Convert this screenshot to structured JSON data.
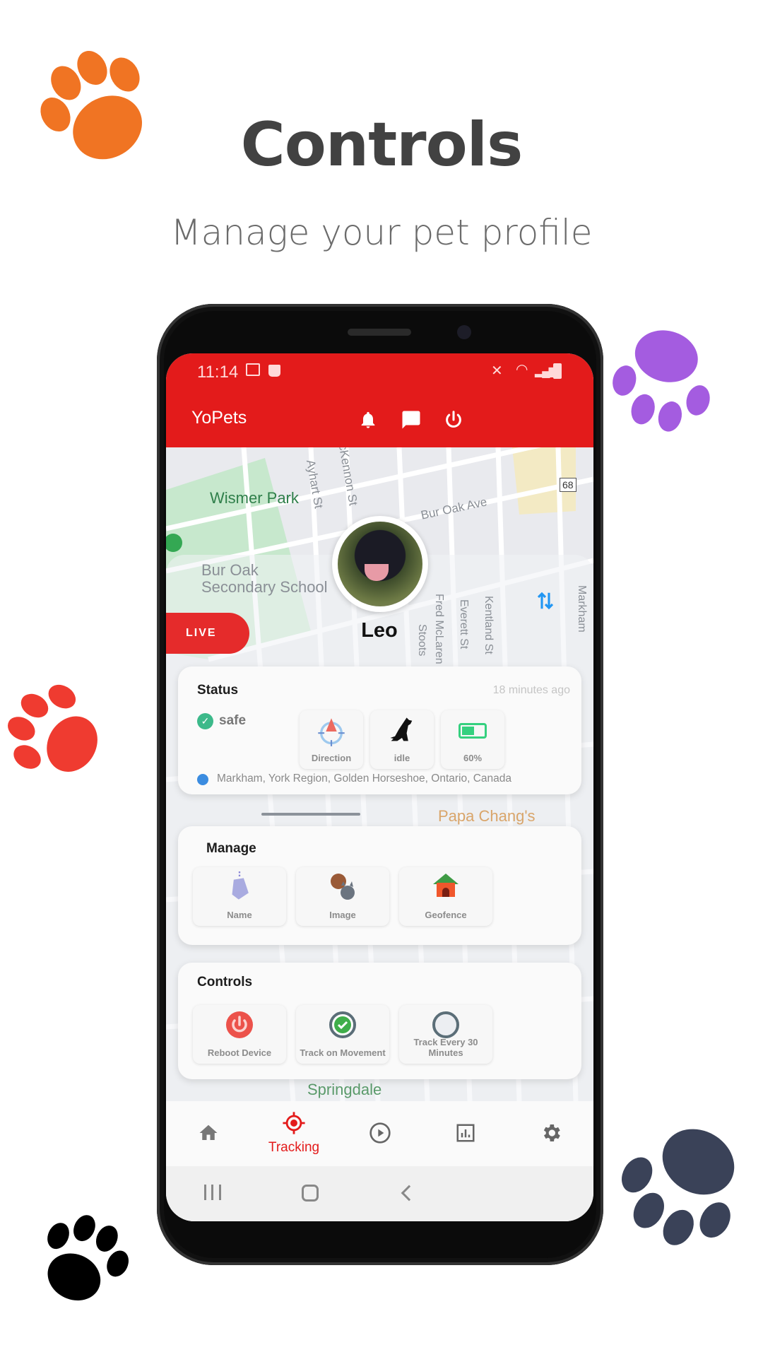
{
  "header": {
    "title": "Controls",
    "subtitle": "Manage your pet profile"
  },
  "paw_colors": [
    "#f07423",
    "#a45ce0",
    "#ef3b30",
    "#000000",
    "#3a4258"
  ],
  "status_bar": {
    "time": "11:14"
  },
  "app_bar": {
    "title": "YoPets",
    "icons": [
      "bell-icon",
      "chat-icon",
      "power-icon"
    ]
  },
  "map": {
    "labels": [
      "Wismer Park",
      "Bur Oak Ave",
      "Ayhart St",
      "McKennon St",
      "Bur Oak Secondary School",
      "Fred McLaren",
      "Everett St",
      "Kentland St",
      "Stoots",
      "Markham",
      "68",
      "Papa Chang's",
      "Springdale"
    ]
  },
  "pet": {
    "name": "Leo",
    "live_label": "LIVE"
  },
  "status_card": {
    "title": "Status",
    "updated": "18 minutes ago",
    "state": "safe",
    "tiles": [
      {
        "label": "Direction",
        "icon": "compass-icon"
      },
      {
        "label": "idle",
        "icon": "dog-sitting-icon"
      },
      {
        "label": "60%",
        "icon": "battery-icon"
      }
    ],
    "battery_level": 0.6,
    "address": "Markham, York Region, Golden Horseshoe, Ontario, Canada"
  },
  "manage_card": {
    "title": "Manage",
    "tiles": [
      {
        "label": "Name",
        "icon": "tag-icon"
      },
      {
        "label": "Image",
        "icon": "dog-cat-icon"
      },
      {
        "label": "Geofence",
        "icon": "dog-house-icon"
      }
    ]
  },
  "controls_card": {
    "title": "Controls",
    "tiles": [
      {
        "label": "Reboot Device",
        "icon": "power-icon"
      },
      {
        "label": "Track on Movement",
        "icon": "radio-checked-icon",
        "selected": true
      },
      {
        "label": "Track Every 30 Minutes",
        "icon": "radio-empty-icon",
        "selected": false
      }
    ]
  },
  "bottom_nav": {
    "items": [
      {
        "icon": "home-icon",
        "label": ""
      },
      {
        "icon": "target-icon",
        "label": "Tracking",
        "active": true
      },
      {
        "icon": "play-icon",
        "label": ""
      },
      {
        "icon": "chart-icon",
        "label": ""
      },
      {
        "icon": "gear-icon",
        "label": ""
      }
    ],
    "active_color": "#e31b1b"
  },
  "accent": "#e31b1b"
}
